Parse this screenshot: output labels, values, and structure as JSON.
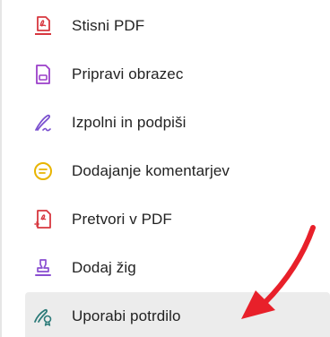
{
  "menu": {
    "items": [
      {
        "label": "Stisni PDF",
        "icon": "compress-pdf-icon",
        "color": "#d7373f"
      },
      {
        "label": "Pripravi obrazec",
        "icon": "prepare-form-icon",
        "color": "#9b3fc9"
      },
      {
        "label": "Izpolni in podpiši",
        "icon": "fill-sign-icon",
        "color": "#7a4fcf"
      },
      {
        "label": "Dodajanje komentarjev",
        "icon": "comment-icon",
        "color": "#e8b400"
      },
      {
        "label": "Pretvori v PDF",
        "icon": "convert-pdf-icon",
        "color": "#d7373f"
      },
      {
        "label": "Dodaj žig",
        "icon": "stamp-icon",
        "color": "#8a4fd1"
      },
      {
        "label": "Uporabi potrdilo",
        "icon": "certificate-icon",
        "color": "#2b7a78",
        "active": true
      }
    ]
  },
  "annotation": {
    "arrow_color": "#e8202a"
  }
}
